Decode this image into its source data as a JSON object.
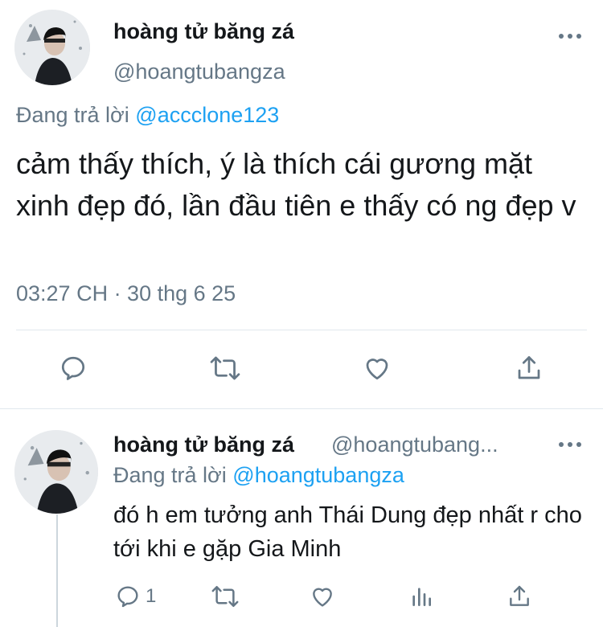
{
  "main_tweet": {
    "name": "hoàng tử băng zá",
    "handle": "@hoangtubangza",
    "reply_prefix": "Đang trả lời",
    "reply_mention": "@accclone123",
    "text": "cảm thấy thích, ý là thích cái gương mặt xinh đẹp đó, lần đầu tiên e thấy có ng đẹp v",
    "timestamp": "03:27 CH · 30 thg 6 25",
    "actions": [
      "reply-icon",
      "retweet-icon",
      "like-icon",
      "share-icon"
    ]
  },
  "reply_tweet": {
    "name": "hoàng tử băng zá",
    "handle": "@hoangtubang...",
    "reply_prefix": "Đang trả lời",
    "reply_mention": "@hoangtubangza",
    "text": "đó h em tưởng anh Thái Dung đẹp nhất r cho tới khi e gặp Gia Minh",
    "reply_count": "1",
    "actions": [
      "reply-icon",
      "retweet-icon",
      "like-icon",
      "analytics-icon",
      "share-icon"
    ]
  },
  "colors": {
    "text": "#14171a",
    "secondary": "#657786",
    "link": "#1da1f2",
    "divider": "#e1e8ed"
  }
}
